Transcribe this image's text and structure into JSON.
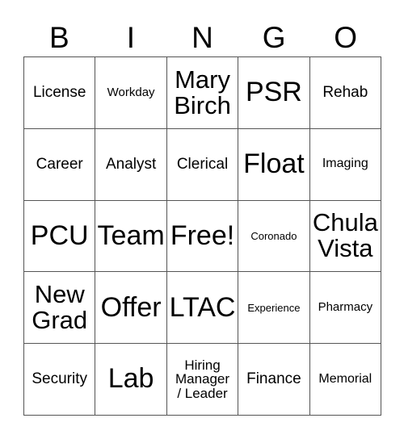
{
  "card": {
    "title": "BINGO",
    "free_space_label": "Free!",
    "border_color": "#555555",
    "text_color": "#000000",
    "background_color": "#ffffff"
  },
  "header": {
    "letters": [
      "B",
      "I",
      "N",
      "G",
      "O"
    ]
  },
  "grid": {
    "columns": 5,
    "rows": 5,
    "cells": [
      [
        {
          "text": "License",
          "size": "lg"
        },
        {
          "text": "Workday",
          "size": "sm"
        },
        {
          "text": "Mary\nBirch",
          "size": "xl"
        },
        {
          "text": "PSR",
          "size": "xxl"
        },
        {
          "text": "Rehab",
          "size": "lg"
        }
      ],
      [
        {
          "text": "Career",
          "size": "lg"
        },
        {
          "text": "Analyst",
          "size": "lg"
        },
        {
          "text": "Clerical",
          "size": "lg"
        },
        {
          "text": "Float",
          "size": "xxl"
        },
        {
          "text": "Imaging",
          "size": "smd"
        }
      ],
      [
        {
          "text": "PCU",
          "size": "xxl"
        },
        {
          "text": "Team",
          "size": "xxl"
        },
        {
          "text": "Free!",
          "size": "xxl"
        },
        {
          "text": "Coronado",
          "size": "xs"
        },
        {
          "text": "Chula\nVista",
          "size": "xl"
        }
      ],
      [
        {
          "text": "New\nGrad",
          "size": "xl"
        },
        {
          "text": "Offer",
          "size": "xxl"
        },
        {
          "text": "LTAC",
          "size": "xxl"
        },
        {
          "text": "Experience",
          "size": "xs"
        },
        {
          "text": "Pharmacy",
          "size": "sm"
        }
      ],
      [
        {
          "text": "Security",
          "size": "lg"
        },
        {
          "text": "Lab",
          "size": "xxl"
        },
        {
          "text": "Hiring\nManager\n/ Leader",
          "size": "md"
        },
        {
          "text": "Finance",
          "size": "lg"
        },
        {
          "text": "Memorial",
          "size": "smd"
        }
      ]
    ]
  }
}
